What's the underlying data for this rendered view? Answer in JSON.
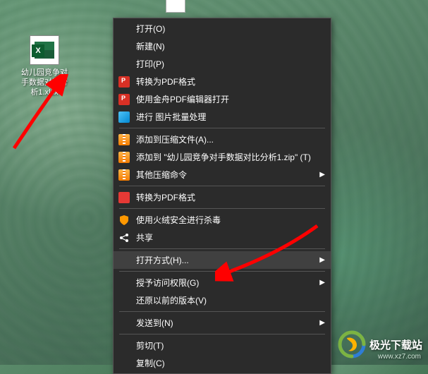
{
  "desktop_file": {
    "label": "幼儿园竞争对手数据对比分析1.xlsx"
  },
  "context_menu": {
    "open": "打开(O)",
    "new": "新建(N)",
    "print": "打印(P)",
    "convert_pdf": "转换为PDF格式",
    "jinzhou_pdf": "使用金舟PDF编辑器打开",
    "batch_image": "进行 图片批量处理",
    "add_archive": "添加到压缩文件(A)...",
    "add_specific_archive": "添加到 \"幼儿园竞争对手数据对比分析1.zip\" (T)",
    "other_compress": "其他压缩命令",
    "convert_pdf2": "转换为PDF格式",
    "huorong_scan": "使用火绒安全进行杀毒",
    "share": "共享",
    "open_with": "打开方式(H)...",
    "grant_access": "授予访问权限(G)",
    "restore_version": "还原以前的版本(V)",
    "send_to": "发送到(N)",
    "cut": "剪切(T)",
    "copy": "复制(C)"
  },
  "watermark": {
    "text": "极光下载站",
    "url": "www.xz7.com"
  }
}
